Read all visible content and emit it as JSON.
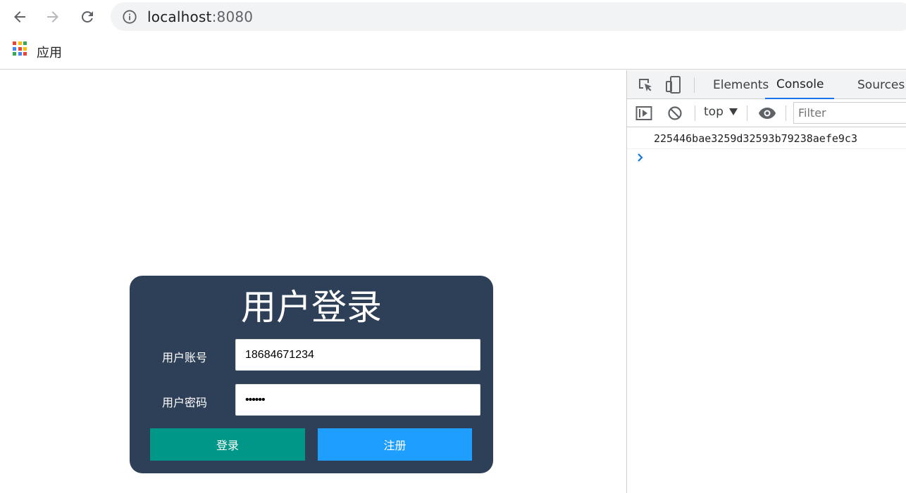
{
  "browser": {
    "url_host": "localhost",
    "url_port": ":8080"
  },
  "bookmarks": {
    "apps_label": "应用",
    "apps_colors": [
      "#ea4335",
      "#fbbc04",
      "#34a853",
      "#4285f4",
      "#ea4335",
      "#fbbc04",
      "#34a853",
      "#4285f4",
      "#ea4335"
    ]
  },
  "login": {
    "title": "用户登录",
    "account_label": "用户账号",
    "account_value": "18684671234",
    "password_label": "用户密码",
    "password_value": "••••••",
    "login_button": "登录",
    "register_button": "注册",
    "card_color": "#2e3f58",
    "login_color": "#009688",
    "register_color": "#1e9fff"
  },
  "devtools": {
    "tabs": [
      "Elements",
      "Console",
      "Sources"
    ],
    "active_tab": "Console",
    "context": "top",
    "filter_placeholder": "Filter",
    "console_output": "225446bae3259d32593b79238aefe9c3"
  }
}
